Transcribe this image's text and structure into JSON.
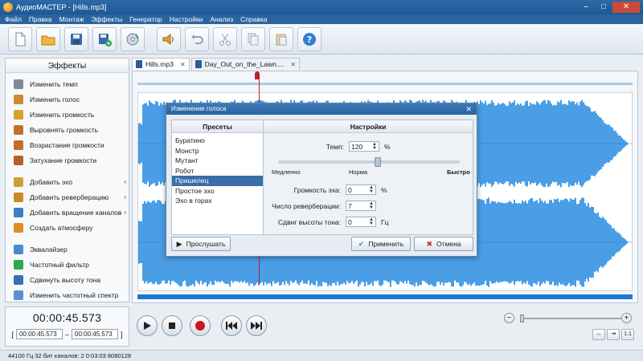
{
  "window": {
    "title": "АудиоМАСТЕР - [Hills.mp3]",
    "min": "–",
    "max": "□",
    "close": "✕"
  },
  "menu": [
    "Файл",
    "Правка",
    "Монтаж",
    "Эффекты",
    "Генератор",
    "Настройки",
    "Анализ",
    "Справка"
  ],
  "toolbar": {
    "buttons": [
      "new-file-icon",
      "open-folder-icon",
      "save-icon",
      "save-as-icon",
      "record-icon",
      "sound-icon",
      "undo-icon",
      "cut-icon",
      "copy-icon",
      "paste-icon",
      "help-icon"
    ]
  },
  "effects_panel": {
    "header": "Эффекты",
    "items": [
      {
        "label": "Изменить темп",
        "icon": "clock-icon",
        "color": "#7c8a98"
      },
      {
        "label": "Изменить голос",
        "icon": "person-icon",
        "color": "#d18a2e"
      },
      {
        "label": "Изменить громкость",
        "icon": "volume-icon",
        "color": "#d9a12f"
      },
      {
        "label": "Выровнять громкость",
        "icon": "volume-level-icon",
        "color": "#c2712a"
      },
      {
        "label": "Возрастание громкости",
        "icon": "volume-up-icon",
        "color": "#c56a2a"
      },
      {
        "label": "Затухание громкости",
        "icon": "volume-down-icon",
        "color": "#b85f26"
      },
      {
        "label": "Добавить эхо",
        "icon": "echo-icon",
        "color": "#d2a030",
        "arrow": "‹"
      },
      {
        "label": "Добавить реверберацию",
        "icon": "reverb-icon",
        "color": "#c98a2c",
        "arrow": "‹"
      },
      {
        "label": "Добавить вращение каналов",
        "icon": "rotate-channels-icon",
        "color": "#3a7fc4",
        "arrow": "‹"
      },
      {
        "label": "Создать атмосферу",
        "icon": "atmosphere-icon",
        "color": "#e08a2a"
      },
      {
        "label": "Эквалайзер",
        "icon": "equalizer-icon",
        "color": "#4a8ad0"
      },
      {
        "label": "Частотный фильтр",
        "icon": "filter-icon",
        "color": "#2ea84a"
      },
      {
        "label": "Сдвинуть высоту тона",
        "icon": "pitch-icon",
        "color": "#3a6fb8"
      },
      {
        "label": "Изменить частотный спектр",
        "icon": "spectrum-icon",
        "color": "#5a8fd0"
      }
    ]
  },
  "tabs": [
    {
      "label": "Hills.mp3",
      "close": "✕",
      "active": true
    },
    {
      "label": "Day_Out_on_the_Lawn....",
      "close": "✕",
      "active": false
    }
  ],
  "dialog": {
    "title": "Изменение голоса",
    "close": "✕",
    "presets_header": "Пресеты",
    "presets": [
      "Буратино",
      "Монстр",
      "Мутант",
      "Робот",
      "Пришелец",
      "Простое эхо",
      "Эхо в горах"
    ],
    "selected_preset": "Пришелец",
    "settings_header": "Настройки",
    "tempo_label": "Темп:",
    "tempo_value": "120",
    "tempo_unit": "%",
    "slider_min": "Медленно",
    "slider_mid": "Норма",
    "slider_max": "Быстро",
    "echo_label": "Громкость эха:",
    "echo_value": "0",
    "echo_unit": "%",
    "reverb_label": "Число реверберации:",
    "reverb_value": "7",
    "pitch_label": "Сдвиг высоты тона:",
    "pitch_value": "0",
    "pitch_unit": "Гц",
    "listen_button": "Прослушать",
    "apply_button": "Применить",
    "cancel_button": "Отмена"
  },
  "time": {
    "current": "00:00:45.573",
    "start": "00:00:45.573",
    "dash": "–",
    "end": "00:00:45.573",
    "bracket_open": "[",
    "bracket_close": "]"
  },
  "zoom": {
    "minus": "−",
    "plus": "+"
  },
  "status": {
    "text": "44100 Гц  32 бит  каналов: 2   0:03:03  8080128"
  },
  "colors": {
    "waveform": "#4a9ee6",
    "accent": "#2a64a0",
    "playhead": "#c0202a"
  }
}
